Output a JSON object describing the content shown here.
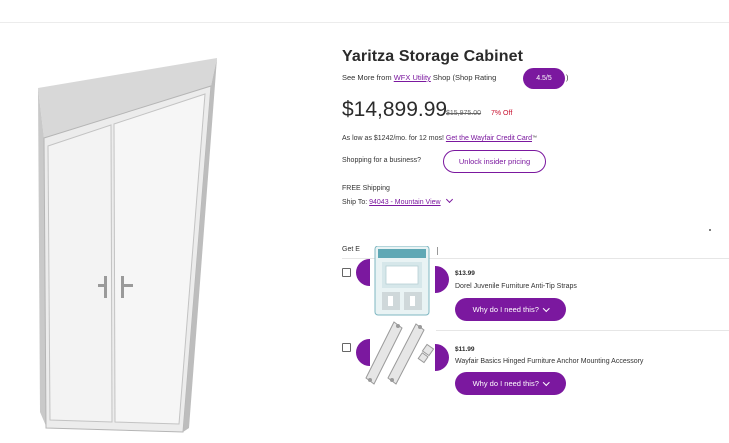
{
  "product": {
    "title": "Yaritza Storage Cabinet",
    "see_more_prefix": "See More from",
    "brand_link": "WFX Utility",
    "shop_text": "Shop (Shop Rating",
    "rating": "4.5/5",
    "rating_close": ")",
    "price": "$14,899.99",
    "original_price": "$15,975.00",
    "discount": "7% Off",
    "financing_text": "As low as $1242/mo. for 12 mos!",
    "financing_link": "Get the Wayfair Credit Card",
    "business_text": "Shopping for a business?",
    "unlock_button": "Unlock insider pricing",
    "shipping": "FREE Shipping",
    "ship_to_label": "Ship To:",
    "ship_to_location": "94043 - Mountain View"
  },
  "accessories": {
    "heading": "Get E",
    "items": [
      {
        "price": "$13.99",
        "name": "Dorel Juvenile Furniture Anti-Tip Straps",
        "button": "Why do I need this?",
        "icon": "anti-tip-straps-package"
      },
      {
        "price": "$11.99",
        "name": "Wayfair Basics Hinged Furniture Anchor Mounting Accessory",
        "button": "Why do I need this?",
        "icon": "hinged-anchor-brackets"
      }
    ]
  },
  "colors": {
    "accent": "#7b189f",
    "discount": "#c8102e",
    "text": "#2b2b2b"
  }
}
